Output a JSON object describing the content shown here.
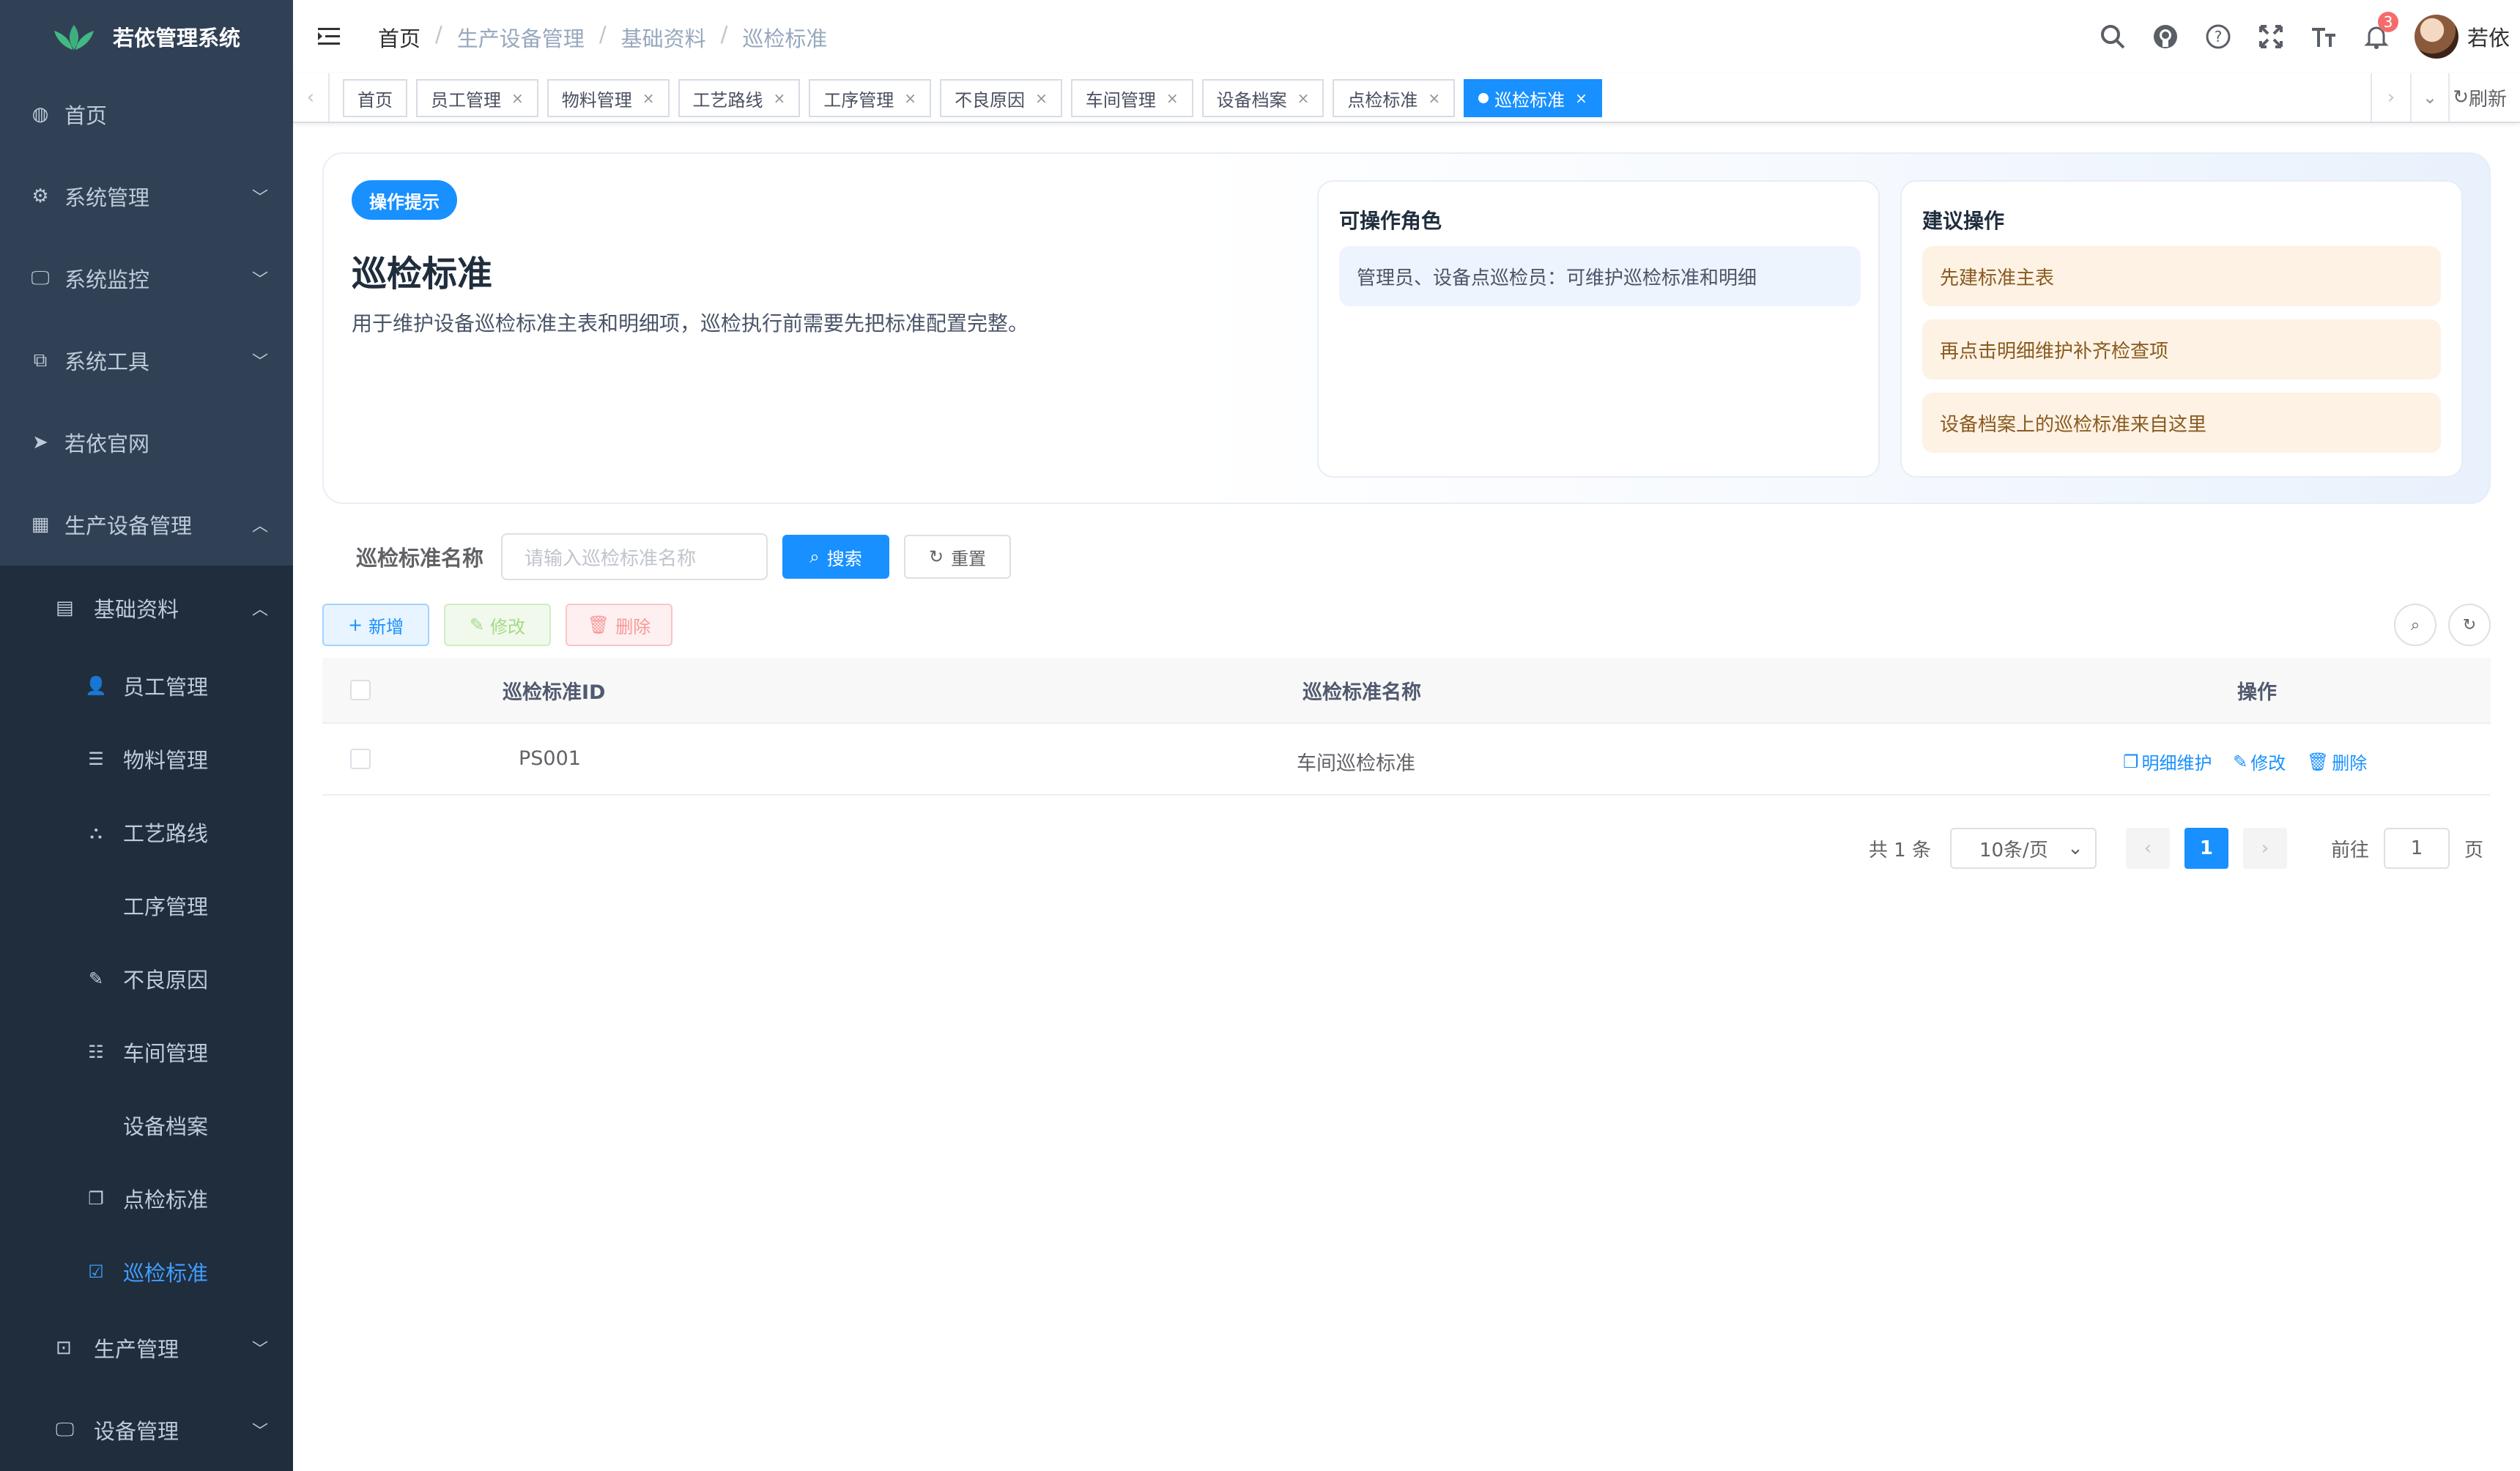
{
  "app": {
    "title": "若依管理系统"
  },
  "sidebar": {
    "top_items": [
      {
        "label": "首页",
        "icon": "dashboard-icon",
        "glyph": "◍",
        "chevron": ""
      },
      {
        "label": "系统管理",
        "icon": "gear-icon",
        "glyph": "⚙",
        "chevron": "﹀"
      },
      {
        "label": "系统监控",
        "icon": "monitor-icon",
        "glyph": "🖵",
        "chevron": "﹀"
      },
      {
        "label": "系统工具",
        "icon": "tool-icon",
        "glyph": "⧉",
        "chevron": "﹀"
      },
      {
        "label": "若依官网",
        "icon": "send-icon",
        "glyph": "➤",
        "chevron": ""
      },
      {
        "label": "生产设备管理",
        "icon": "table-icon",
        "glyph": "▦",
        "chevron": "︿"
      }
    ],
    "group": {
      "label": "基础资料",
      "icon": "document-icon",
      "glyph": "▤",
      "chevron": "︿"
    },
    "sub_items": [
      {
        "label": "员工管理",
        "icon": "user-icon",
        "glyph": "👤"
      },
      {
        "label": "物料管理",
        "icon": "list-icon",
        "glyph": "☰"
      },
      {
        "label": "工艺路线",
        "icon": "tree-icon",
        "glyph": "⛬"
      },
      {
        "label": "工序管理",
        "icon": "",
        "glyph": ""
      },
      {
        "label": "不良原因",
        "icon": "edit-icon",
        "glyph": "✎"
      },
      {
        "label": "车间管理",
        "icon": "tree-table-icon",
        "glyph": "☷"
      },
      {
        "label": "设备档案",
        "icon": "",
        "glyph": ""
      },
      {
        "label": "点检标准",
        "icon": "copy-icon",
        "glyph": "❐"
      },
      {
        "label": "巡检标准",
        "icon": "checkbox-icon",
        "glyph": "☑"
      }
    ],
    "bottom_items": [
      {
        "label": "生产管理",
        "icon": "production-icon",
        "glyph": "⊡",
        "chevron": "﹀"
      },
      {
        "label": "设备管理",
        "icon": "equipment-icon",
        "glyph": "🖵",
        "chevron": "﹀"
      }
    ]
  },
  "navbar": {
    "breadcrumb": [
      "首页",
      "生产设备管理",
      "基础资料",
      "巡检标准"
    ],
    "notification_count": "3",
    "user_name": "若依"
  },
  "tags": {
    "items": [
      "首页",
      "员工管理",
      "物料管理",
      "工艺路线",
      "工序管理",
      "不良原因",
      "车间管理",
      "设备档案",
      "点检标准",
      "巡检标准"
    ],
    "active": "巡检标准",
    "refresh_label": "刷新"
  },
  "hero": {
    "badge": "操作提示",
    "title": "巡检标准",
    "description": "用于维护设备巡检标准主表和明细项，巡检执行前需要先把标准配置完整。",
    "roles_title": "可操作角色",
    "roles_text": "管理员、设备点巡检员：可维护巡检标准和明细",
    "suggest_title": "建议操作",
    "suggestions": [
      "先建标准主表",
      "再点击明细维护补齐检查项",
      "设备档案上的巡检标准来自这里"
    ]
  },
  "search": {
    "label": "巡检标准名称",
    "placeholder": "请输入巡检标准名称",
    "search_btn": "搜索",
    "reset_btn": "重置"
  },
  "toolbar": {
    "add": "新增",
    "edit": "修改",
    "delete": "删除"
  },
  "table": {
    "headers": {
      "id": "巡检标准ID",
      "name": "巡检标准名称",
      "ops": "操作"
    },
    "rows": [
      {
        "id": "PS001",
        "name": "车间巡检标准"
      }
    ],
    "ops": {
      "detail": "明细维护",
      "edit": "修改",
      "delete": "删除"
    }
  },
  "pagination": {
    "total": "共 1 条",
    "page_size": "10条/页",
    "current": "1",
    "goto_label": "前往",
    "goto_value": "1",
    "page_suffix": "页"
  },
  "colors": {
    "primary": "#1890ff",
    "sidebar": "#304156",
    "submenu": "#1f2d3d",
    "active_menu": "#409eff"
  }
}
